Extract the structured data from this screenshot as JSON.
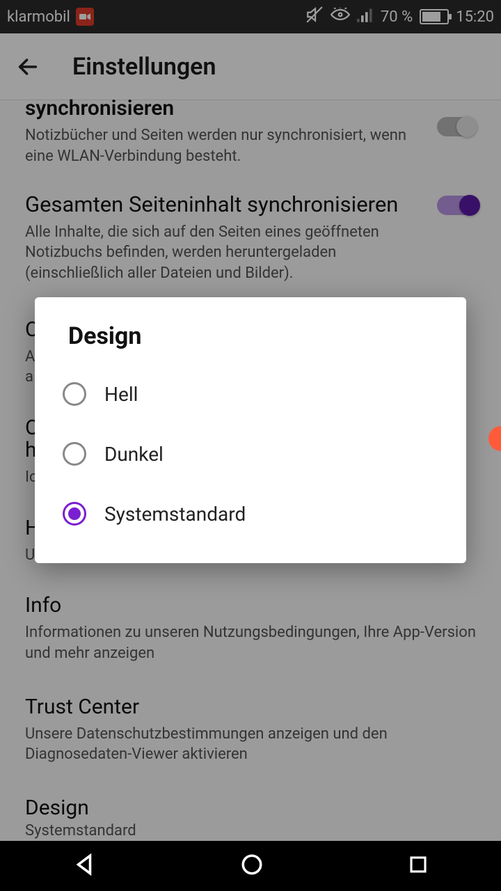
{
  "status": {
    "carrier": "klarmobil",
    "battery_pct": "70 %",
    "time": "15:20"
  },
  "appbar": {
    "title": "Einstellungen"
  },
  "settings": {
    "s0": {
      "title": "synchronisieren",
      "desc": "Notizbücher und Seiten werden nur synchronisiert, wenn eine WLAN-Verbindung besteht."
    },
    "s1": {
      "title": "Gesamten Seiteninhalt synchronisieren",
      "desc": "Alle Inhalte, die sich auf den Seiten eines geöffneten Notizbuchs befinden, werden heruntergeladen (einschließlich aller Dateien und Bilder)."
    },
    "s2": {
      "title_a": "O",
      "desc_a": "A",
      "desc_b": "a"
    },
    "s3": {
      "title_a": "O",
      "title_b": "h",
      "desc": "Io"
    },
    "s4": {
      "title": "H",
      "desc": "U"
    },
    "s5": {
      "title": "Info",
      "desc": "Informationen zu unseren Nutzungsbedingungen, Ihre App-Version und mehr anzeigen"
    },
    "s6": {
      "title": "Trust Center",
      "desc": "Unsere Datenschutzbestimmungen anzeigen und den Diagnosedaten-Viewer aktivieren"
    },
    "s7": {
      "title": "Design",
      "sub": "Systemstandard"
    }
  },
  "dialog": {
    "title": "Design",
    "options": {
      "o0": "Hell",
      "o1": "Dunkel",
      "o2": "Systemstandard"
    }
  }
}
